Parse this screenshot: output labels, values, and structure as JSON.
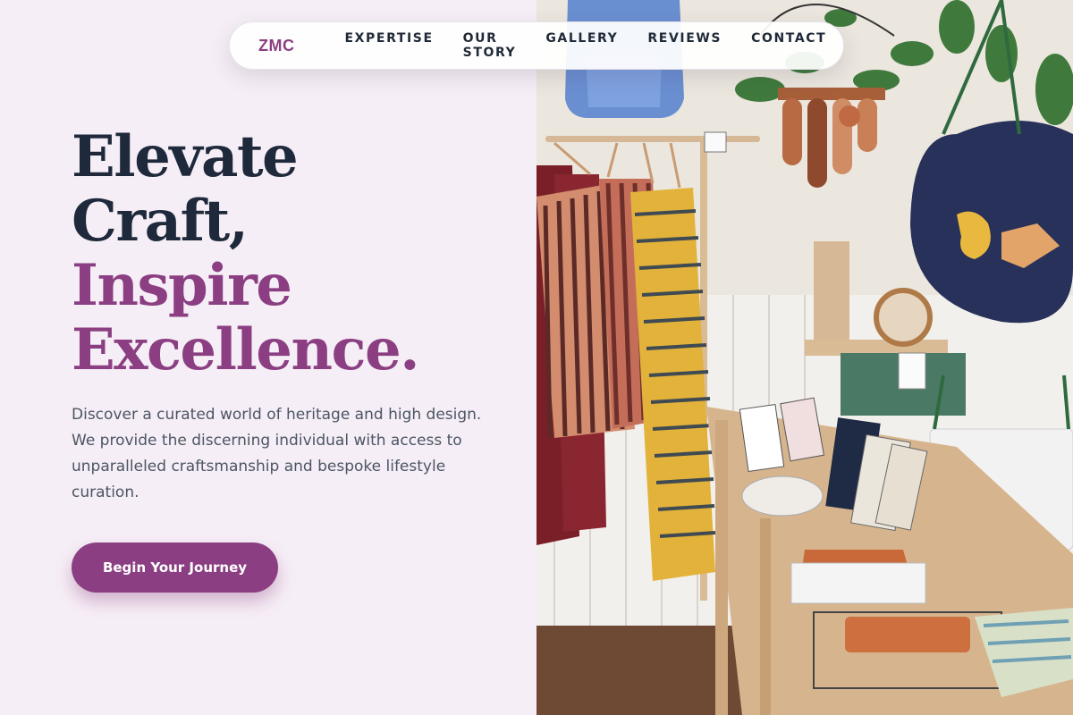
{
  "nav": {
    "logo": "ZMC",
    "links": [
      "EXPERTISE",
      "OUR STORY",
      "GALLERY",
      "REVIEWS",
      "CONTACT"
    ]
  },
  "hero": {
    "headline_dark": [
      "Elevate",
      "Craft,"
    ],
    "headline_accent": [
      "Inspire",
      "Excellence."
    ],
    "description": "Discover a curated world of heritage and high design. We provide the discerning individual with access to unparalleled craftsmanship and bespoke lifestyle curation.",
    "cta_label": "Begin Your Journey"
  },
  "colors": {
    "accent": "#8b3f82",
    "heading": "#1e293b",
    "body_text": "#4b5563",
    "background": "#f6eef6"
  },
  "image": {
    "subject": "boutique-interior-photo"
  }
}
